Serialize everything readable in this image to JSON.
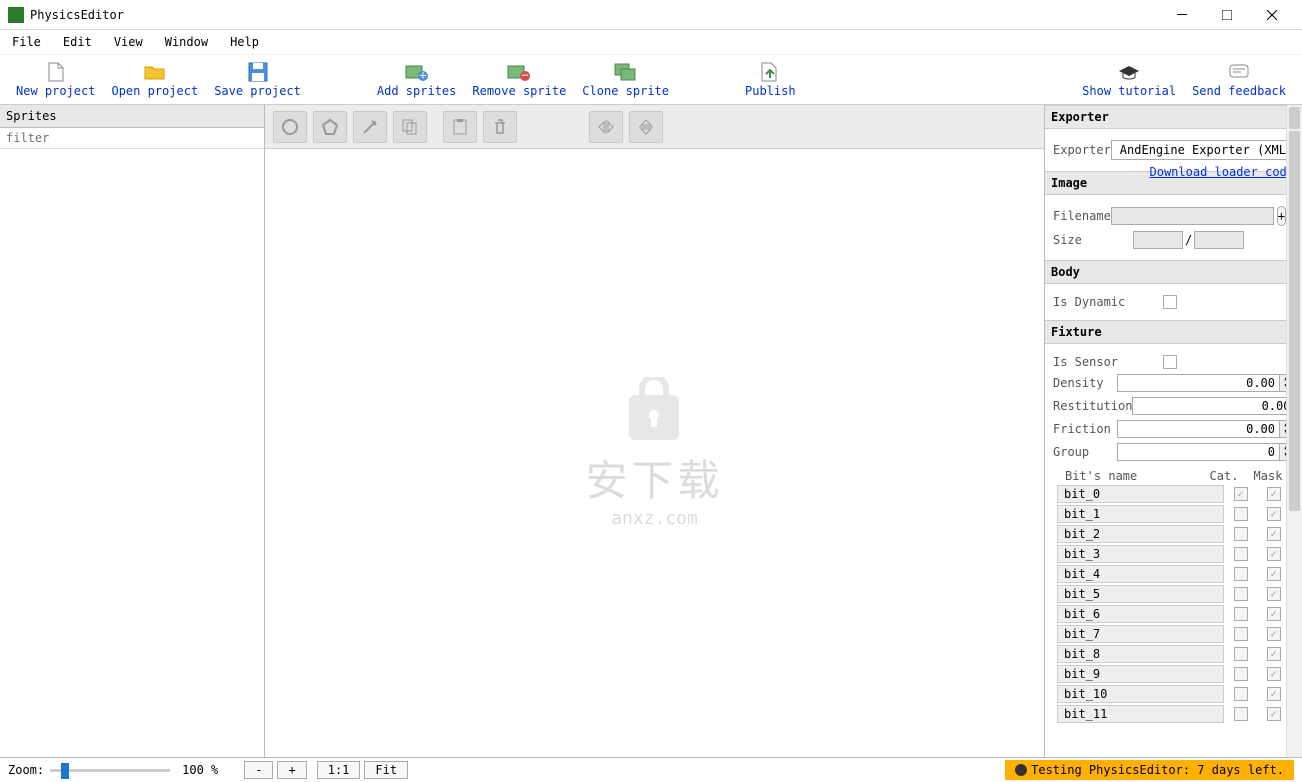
{
  "window": {
    "title": "PhysicsEditor"
  },
  "menu": {
    "file": "File",
    "edit": "Edit",
    "view": "View",
    "window": "Window",
    "help": "Help"
  },
  "toolbar": {
    "new": "New project",
    "open": "Open project",
    "save": "Save project",
    "add": "Add sprites",
    "remove": "Remove sprite",
    "clone": "Clone sprite",
    "publish": "Publish",
    "tutorial": "Show tutorial",
    "feedback": "Send feedback"
  },
  "left": {
    "header": "Sprites",
    "filter_placeholder": "filter"
  },
  "right": {
    "exporter_head": "Exporter",
    "exporter_label": "Exporter",
    "exporter_value": "AndEngine Exporter (XML)",
    "loader_link": "Download loader code",
    "image_head": "Image",
    "filename_label": "Filename",
    "size_label": "Size",
    "body_head": "Body",
    "is_dynamic": "Is Dynamic",
    "fixture_head": "Fixture",
    "is_sensor": "Is Sensor",
    "density": "Density",
    "density_v": "0.00",
    "restitution": "Restitution",
    "restitution_v": "0.00",
    "friction": "Friction",
    "friction_v": "0.00",
    "group": "Group",
    "group_v": "0",
    "bits_name": "Bit's name",
    "cat": "Cat.",
    "mask": "Mask",
    "bits": [
      {
        "name": "bit_0",
        "cat": true,
        "mask": true
      },
      {
        "name": "bit_1",
        "cat": false,
        "mask": true
      },
      {
        "name": "bit_2",
        "cat": false,
        "mask": true
      },
      {
        "name": "bit_3",
        "cat": false,
        "mask": true
      },
      {
        "name": "bit_4",
        "cat": false,
        "mask": true
      },
      {
        "name": "bit_5",
        "cat": false,
        "mask": true
      },
      {
        "name": "bit_6",
        "cat": false,
        "mask": true
      },
      {
        "name": "bit_7",
        "cat": false,
        "mask": true
      },
      {
        "name": "bit_8",
        "cat": false,
        "mask": true
      },
      {
        "name": "bit_9",
        "cat": false,
        "mask": true
      },
      {
        "name": "bit_10",
        "cat": false,
        "mask": true
      },
      {
        "name": "bit_11",
        "cat": false,
        "mask": true
      }
    ]
  },
  "status": {
    "zoom_label": "Zoom:",
    "zoom_pct": "100 %",
    "minus": "-",
    "plus": "+",
    "one": "1:1",
    "fit": "Fit",
    "trial": "Testing PhysicsEditor: 7 days left."
  }
}
